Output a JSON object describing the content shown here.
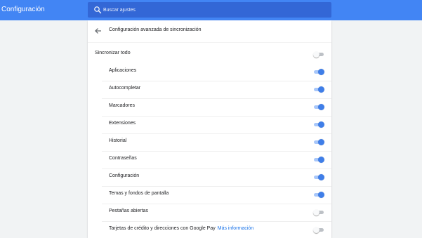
{
  "header": {
    "title": "Configuración",
    "search_placeholder": "Buscar ajustes",
    "search_value": ""
  },
  "page": {
    "title": "Configuración avanzada de sincronización",
    "back_icon": "arrow-left-icon"
  },
  "sync_all": {
    "label": "Sincronizar todo",
    "checked": false
  },
  "items": [
    {
      "label": "Aplicaciones",
      "checked": true
    },
    {
      "label": "Autocompletar",
      "checked": true
    },
    {
      "label": "Marcadores",
      "checked": true
    },
    {
      "label": "Extensiones",
      "checked": true
    },
    {
      "label": "Historial",
      "checked": true
    },
    {
      "label": "Contraseñas",
      "checked": true
    },
    {
      "label": "Configuración",
      "checked": true
    },
    {
      "label": "Temas y fondos de pantalla",
      "checked": true
    },
    {
      "label": "Pestañas abiertas",
      "checked": false
    },
    {
      "label": "Tarjetas de crédito y direcciones con Google Pay",
      "link_label": "Más información",
      "checked": false
    }
  ],
  "colors": {
    "topbar": "#4285f4",
    "search_bg": "#3367d6",
    "toggle_on": "#3f7ee8",
    "toggle_on_track": "#a8c7fa",
    "toggle_off_track": "#bdc1c6",
    "link": "#1a73e8"
  }
}
